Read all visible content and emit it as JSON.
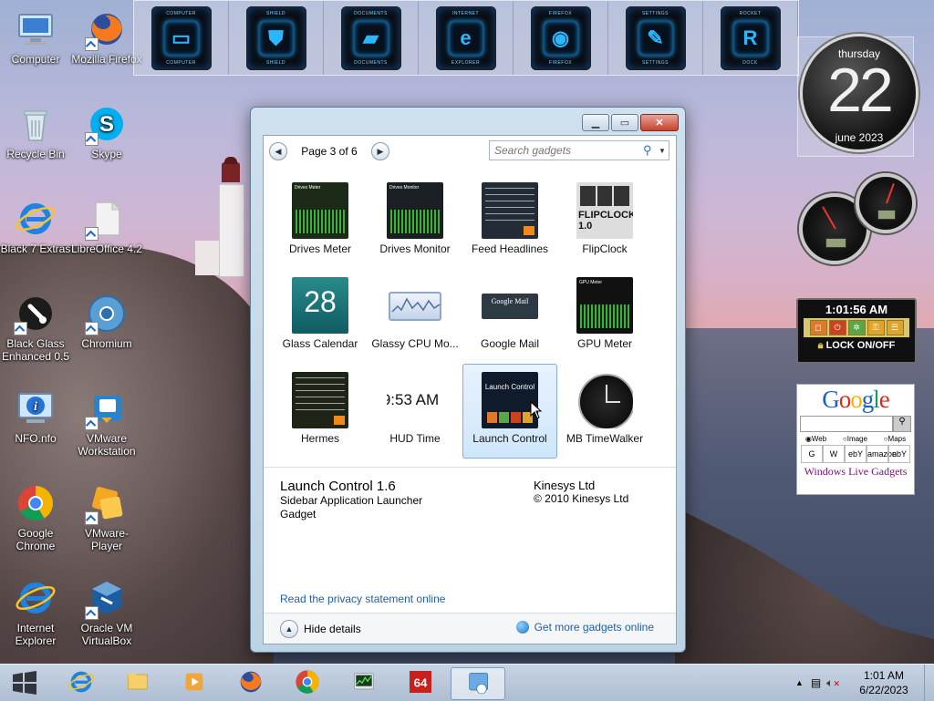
{
  "desktop": {
    "icons_left": [
      {
        "label": "Computer",
        "icon": "computer-icon",
        "shortcut": false
      },
      {
        "label": "Recycle Bin",
        "icon": "recycle-bin-icon",
        "shortcut": false
      },
      {
        "label": "Black 7 Extras",
        "icon": "ie-icon",
        "shortcut": false
      },
      {
        "label": "Black Glass Enhanced 0.5",
        "icon": "black-glass-icon",
        "shortcut": true
      },
      {
        "label": "NFO.nfo",
        "icon": "info-icon",
        "shortcut": false
      },
      {
        "label": "Google Chrome",
        "icon": "chrome-icon",
        "shortcut": false
      },
      {
        "label": "Internet Explorer",
        "icon": "ie-icon",
        "shortcut": false
      }
    ],
    "icons_right": [
      {
        "label": "Mozilla Firefox",
        "icon": "firefox-icon",
        "shortcut": true
      },
      {
        "label": "Skype",
        "icon": "skype-icon",
        "shortcut": true
      },
      {
        "label": "LibreOffice 4.2",
        "icon": "libreoffice-icon",
        "shortcut": true
      },
      {
        "label": "Chromium",
        "icon": "chromium-icon",
        "shortcut": true
      },
      {
        "label": "VMware Workstation",
        "icon": "vmware-icon",
        "shortcut": true
      },
      {
        "label": "VMware-Player",
        "icon": "vmware-player-icon",
        "shortcut": true
      },
      {
        "label": "Oracle VM VirtualBox",
        "icon": "virtualbox-icon",
        "shortcut": true
      }
    ]
  },
  "launcher": {
    "items": [
      {
        "top": "COMPUTER",
        "bottom": "COMPUTER",
        "icon": "monitor-icon",
        "glyph": "▭"
      },
      {
        "top": "SHIELD",
        "bottom": "SHIELD",
        "icon": "shield-icon",
        "glyph": "⛊"
      },
      {
        "top": "DOCUMENTS",
        "bottom": "DOCUMENTS",
        "icon": "folder-icon",
        "glyph": "▰"
      },
      {
        "top": "INTERNET",
        "bottom": "EXPLORER",
        "icon": "ie-icon",
        "glyph": "e"
      },
      {
        "top": "FIREFOX",
        "bottom": "FIREFOX",
        "icon": "firefox-icon",
        "glyph": "◉"
      },
      {
        "top": "SETTINGS",
        "bottom": "SETTINGS",
        "icon": "wrench-icon",
        "glyph": "✎"
      },
      {
        "top": "ROCKET",
        "bottom": "DOCK",
        "icon": "rocket-dock-icon",
        "glyph": "R"
      }
    ]
  },
  "window": {
    "pager": {
      "label": "Page 3 of 6"
    },
    "search": {
      "placeholder": "Search gadgets"
    },
    "gadgets": [
      {
        "name": "Drives Meter",
        "thumb_text": "Drives Meter",
        "selected": false
      },
      {
        "name": "Drives Monitor",
        "thumb_text": "Drives Monitor",
        "selected": false
      },
      {
        "name": "Feed Headlines",
        "thumb_text": "",
        "selected": false
      },
      {
        "name": "FlipClock",
        "thumb_text": "FLIPCLOCK 1.0",
        "selected": false
      },
      {
        "name": "Glass Calendar",
        "thumb_text": "28",
        "selected": false
      },
      {
        "name": "Glassy CPU Mo...",
        "thumb_text": "",
        "selected": false
      },
      {
        "name": "Google Mail",
        "thumb_text": "Google Mail",
        "selected": false
      },
      {
        "name": "GPU Meter",
        "thumb_text": "GPU Meter",
        "selected": false
      },
      {
        "name": "Hermes",
        "thumb_text": "",
        "selected": false
      },
      {
        "name": "HUD Time",
        "thumb_text": "9:53 AM",
        "selected": false
      },
      {
        "name": "Launch Control",
        "thumb_text": "Launch Control",
        "selected": true
      },
      {
        "name": "MB TimeWalker",
        "thumb_text": "",
        "selected": false
      }
    ],
    "details": {
      "title": "Launch Control 1.6",
      "description": "Sidebar Application Launcher Gadget",
      "author": "Kinesys Ltd",
      "copyright": "© 2010 Kinesys Ltd",
      "privacy_link": "Read the privacy statement online"
    },
    "footer": {
      "hide_details": "Hide details",
      "get_more": "Get more gadgets online"
    }
  },
  "sidebar": {
    "clock": {
      "day": "thursday",
      "date": "22",
      "month": "june 2023"
    },
    "lock": {
      "time": "1:01:56 AM",
      "label": "LOCK ON/OFF"
    },
    "google": {
      "logo": "Google",
      "radios": [
        "Web",
        "Image",
        "Maps"
      ],
      "links": [
        "G",
        "W",
        "ebY",
        "amazon",
        "ebY"
      ],
      "footer": "Windows Live Gadgets"
    }
  },
  "taskbar": {
    "apps": [
      {
        "icon": "ie-icon"
      },
      {
        "icon": "explorer-icon"
      },
      {
        "icon": "media-player-icon"
      },
      {
        "icon": "firefox-icon"
      },
      {
        "icon": "chrome-icon"
      },
      {
        "icon": "task-manager-icon"
      },
      {
        "icon": "aida64-icon",
        "text": "64"
      },
      {
        "icon": "gadgets-icon",
        "active": true
      }
    ],
    "clock_time": "1:01 AM",
    "clock_date": "6/22/2023"
  },
  "colors": {
    "link": "#1f5fa8",
    "launcher_glow": "#19a3ff",
    "selection_bg": "#cfe6fb"
  }
}
